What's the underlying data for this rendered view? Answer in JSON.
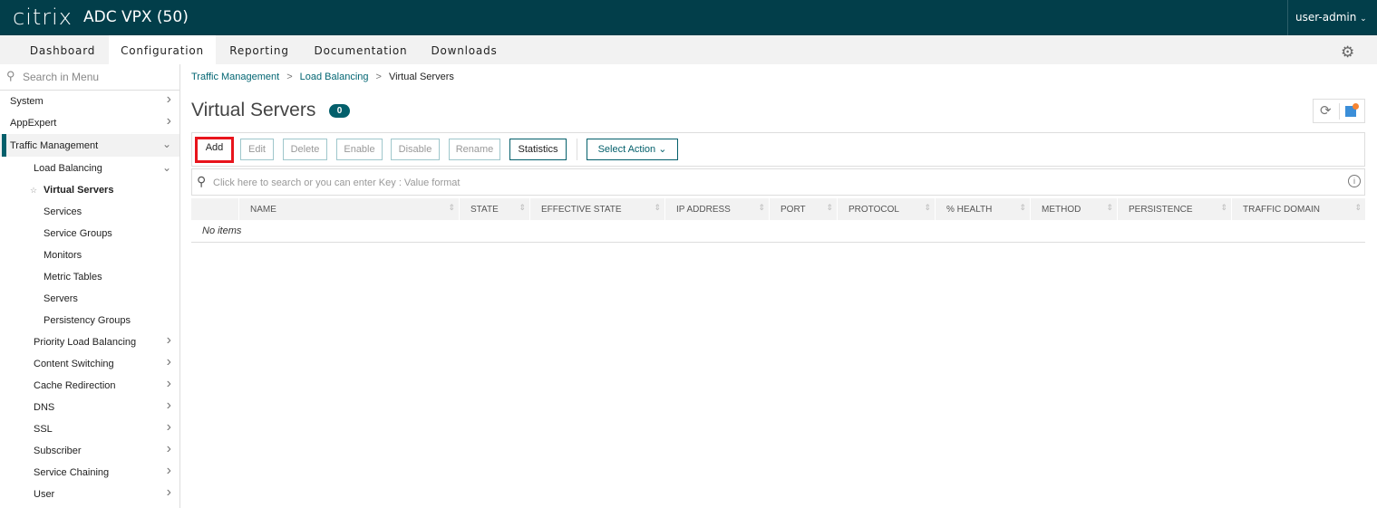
{
  "header": {
    "logo": "citrix",
    "app_title": "ADC VPX (50)",
    "user": "user-admin"
  },
  "nav": {
    "tabs": [
      "Dashboard",
      "Configuration",
      "Reporting",
      "Documentation",
      "Downloads"
    ],
    "active": "Configuration"
  },
  "sidebar": {
    "search_placeholder": "Search in Menu",
    "items": [
      {
        "label": "System",
        "level": 0,
        "chev": ">"
      },
      {
        "label": "AppExpert",
        "level": 0,
        "chev": ">"
      },
      {
        "label": "Traffic Management",
        "level": 0,
        "chev": "v",
        "selected": true
      },
      {
        "label": "Load Balancing",
        "level": 1,
        "chev": "v"
      },
      {
        "label": "Virtual Servers",
        "level": 2,
        "active": true
      },
      {
        "label": "Services",
        "level": 2
      },
      {
        "label": "Service Groups",
        "level": 2
      },
      {
        "label": "Monitors",
        "level": 2
      },
      {
        "label": "Metric Tables",
        "level": 2
      },
      {
        "label": "Servers",
        "level": 2
      },
      {
        "label": "Persistency Groups",
        "level": 2
      },
      {
        "label": "Priority Load Balancing",
        "level": 1,
        "chev": ">"
      },
      {
        "label": "Content Switching",
        "level": 1,
        "chev": ">"
      },
      {
        "label": "Cache Redirection",
        "level": 1,
        "chev": ">"
      },
      {
        "label": "DNS",
        "level": 1,
        "chev": ">"
      },
      {
        "label": "SSL",
        "level": 1,
        "chev": ">"
      },
      {
        "label": "Subscriber",
        "level": 1,
        "chev": ">"
      },
      {
        "label": "Service Chaining",
        "level": 1,
        "chev": ">"
      },
      {
        "label": "User",
        "level": 1,
        "chev": ">"
      }
    ]
  },
  "breadcrumb": [
    "Traffic Management",
    "Load Balancing",
    "Virtual Servers"
  ],
  "page": {
    "title": "Virtual Servers",
    "count": "0"
  },
  "toolbar": {
    "add": "Add",
    "edit": "Edit",
    "delete": "Delete",
    "enable": "Enable",
    "disable": "Disable",
    "rename": "Rename",
    "statistics": "Statistics",
    "select_action": "Select Action"
  },
  "search": {
    "placeholder": "Click here to search or you can enter Key : Value format"
  },
  "table": {
    "columns": [
      "NAME",
      "STATE",
      "EFFECTIVE STATE",
      "IP ADDRESS",
      "PORT",
      "PROTOCOL",
      "% HEALTH",
      "METHOD",
      "PERSISTENCE",
      "TRAFFIC DOMAIN"
    ],
    "empty": "No items"
  },
  "colors": {
    "header_bg": "#023e4a",
    "accent": "#035f6b",
    "highlight": "#e8141c"
  }
}
